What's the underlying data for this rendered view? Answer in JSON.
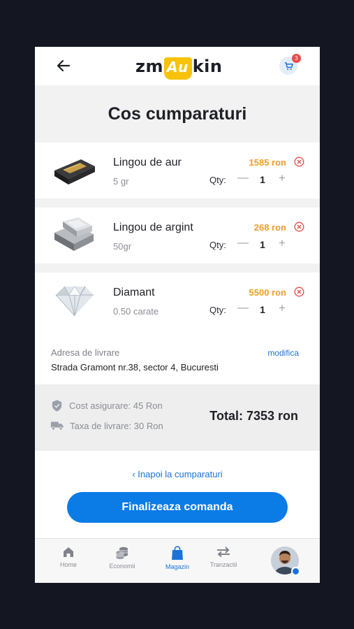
{
  "header": {
    "logo_left": "zm",
    "logo_mid": "Au",
    "logo_right": "kin",
    "cart_count": "3"
  },
  "title": "Cos cumparaturi",
  "items": [
    {
      "name": "Lingou de aur",
      "sub": "5 gr",
      "price": "1585 ron",
      "qty_label": "Qty:",
      "qty": "1"
    },
    {
      "name": "Lingou de argint",
      "sub": "50gr",
      "price": "268 ron",
      "qty_label": "Qty:",
      "qty": "1"
    },
    {
      "name": "Diamant",
      "sub": "0.50 carate",
      "price": "5500 ron",
      "qty_label": "Qty:",
      "qty": "1"
    }
  ],
  "address": {
    "label": "Adresa de livrare",
    "value": "Strada Gramont nr.38, sector 4, Bucuresti",
    "edit": "modifica"
  },
  "summary": {
    "insurance": "Cost asigurare: 45 Ron",
    "delivery": "Taxa de livrare: 30 Ron",
    "total": "Total: 7353 ron"
  },
  "actions": {
    "back": "Inapoi la cumparaturi",
    "finalize": "Finalizeaza comanda"
  },
  "tabs": [
    {
      "label": "Home",
      "icon": "home-icon"
    },
    {
      "label": "Economii",
      "icon": "coins-icon"
    },
    {
      "label": "Magazin",
      "icon": "shopping-bag-icon"
    },
    {
      "label": "Tranzactii",
      "icon": "transfer-arrows-icon"
    }
  ],
  "colors": {
    "accent": "#0b7be6",
    "price": "#f39c26",
    "remove": "#e84a4a",
    "logo_gold": "#f7c20a"
  }
}
